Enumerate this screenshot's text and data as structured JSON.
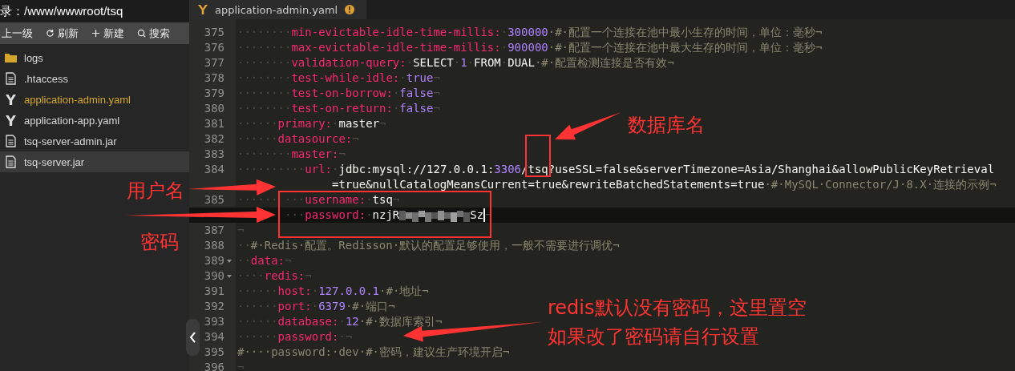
{
  "file_panel": {
    "path": "录：/www/wwwroot/tsq",
    "toolbar": [
      {
        "kind": "up",
        "label": "上一级"
      },
      {
        "kind": "refresh",
        "label": "刷新"
      },
      {
        "kind": "new",
        "label": "新建"
      },
      {
        "kind": "search",
        "label": "搜索"
      }
    ],
    "files": [
      {
        "kind": "folder",
        "name": "logs",
        "selected": false,
        "hovered": false
      },
      {
        "kind": "doc",
        "name": ".htaccess",
        "selected": false,
        "hovered": false
      },
      {
        "kind": "yaml",
        "name": "application-admin.yaml",
        "selected": true,
        "hovered": false
      },
      {
        "kind": "yaml",
        "name": "application-app.yaml",
        "selected": false,
        "hovered": false
      },
      {
        "kind": "doc",
        "name": "tsq-server-admin.jar",
        "selected": false,
        "hovered": false
      },
      {
        "kind": "doc",
        "name": "tsq-server.jar",
        "selected": false,
        "hovered": true
      }
    ]
  },
  "editor": {
    "tab": {
      "title": "application-admin.yaml",
      "warning": true
    },
    "lines": [
      {
        "number": "375",
        "current": false,
        "tokens": [
          {
            "kind": "ws",
            "text": "········"
          },
          {
            "kind": "key",
            "text": "min-evictable-idle-time-millis:"
          },
          {
            "kind": "ws",
            "text": "·"
          },
          {
            "kind": "number",
            "text": "300000"
          },
          {
            "kind": "comment",
            "text": "·#·配置一个连接在池中最小生存的时间，单位：毫秒¬"
          }
        ]
      },
      {
        "number": "376",
        "current": false,
        "tokens": [
          {
            "kind": "ws",
            "text": "········"
          },
          {
            "kind": "key",
            "text": "max-evictable-idle-time-millis:"
          },
          {
            "kind": "ws",
            "text": "·"
          },
          {
            "kind": "number",
            "text": "900000"
          },
          {
            "kind": "comment",
            "text": "·#·配置一个连接在池中最大生存的时间，单位：毫秒¬"
          }
        ]
      },
      {
        "number": "377",
        "current": false,
        "tokens": [
          {
            "kind": "ws",
            "text": "········"
          },
          {
            "kind": "key",
            "text": "validation-query:"
          },
          {
            "kind": "ws",
            "text": "·"
          },
          {
            "kind": "plain",
            "text": "SELECT"
          },
          {
            "kind": "ws",
            "text": "·"
          },
          {
            "kind": "number",
            "text": "1"
          },
          {
            "kind": "ws",
            "text": "·"
          },
          {
            "kind": "plain",
            "text": "FROM"
          },
          {
            "kind": "ws",
            "text": "·"
          },
          {
            "kind": "plain",
            "text": "DUAL"
          },
          {
            "kind": "comment",
            "text": "·#·配置检测连接是否有效¬"
          }
        ]
      },
      {
        "number": "378",
        "current": false,
        "tokens": [
          {
            "kind": "ws",
            "text": "········"
          },
          {
            "kind": "key",
            "text": "test-while-idle:"
          },
          {
            "kind": "ws",
            "text": "·"
          },
          {
            "kind": "number",
            "text": "true"
          },
          {
            "kind": "ws",
            "text": "¬"
          }
        ]
      },
      {
        "number": "379",
        "current": false,
        "tokens": [
          {
            "kind": "ws",
            "text": "········"
          },
          {
            "kind": "key",
            "text": "test-on-borrow:"
          },
          {
            "kind": "ws",
            "text": "·"
          },
          {
            "kind": "number",
            "text": "false"
          },
          {
            "kind": "ws",
            "text": "¬"
          }
        ]
      },
      {
        "number": "380",
        "current": false,
        "tokens": [
          {
            "kind": "ws",
            "text": "········"
          },
          {
            "kind": "key",
            "text": "test-on-return:"
          },
          {
            "kind": "ws",
            "text": "·"
          },
          {
            "kind": "number",
            "text": "false"
          },
          {
            "kind": "ws",
            "text": "¬"
          }
        ]
      },
      {
        "number": "381",
        "current": false,
        "tokens": [
          {
            "kind": "ws",
            "text": "······"
          },
          {
            "kind": "key",
            "text": "primary:"
          },
          {
            "kind": "ws",
            "text": "·"
          },
          {
            "kind": "plain",
            "text": "master"
          },
          {
            "kind": "ws",
            "text": "¬"
          }
        ]
      },
      {
        "number": "382",
        "current": false,
        "tokens": [
          {
            "kind": "ws",
            "text": "······"
          },
          {
            "kind": "key",
            "text": "datasource:"
          },
          {
            "kind": "ws",
            "text": "¬"
          }
        ]
      },
      {
        "number": "383",
        "current": false,
        "tokens": [
          {
            "kind": "ws",
            "text": "········"
          },
          {
            "kind": "key",
            "text": "master:"
          },
          {
            "kind": "ws",
            "text": "¬"
          }
        ]
      },
      {
        "number": "384",
        "current": false,
        "tokens": [
          {
            "kind": "ws",
            "text": "··········"
          },
          {
            "kind": "key",
            "text": "url:"
          },
          {
            "kind": "ws",
            "text": "·"
          },
          {
            "kind": "plain",
            "text": "jdbc:mysql://127.0.0.1:"
          },
          {
            "kind": "number",
            "text": "3306"
          },
          {
            "kind": "plain",
            "text": "/tsq?useSSL=false&serverTimezone=Asia/Shanghai&allowPublicKeyRetrieval"
          }
        ],
        "continuation": [
          {
            "kind": "plain",
            "text": "=true&nullCatalogMeansCurrent=true&rewriteBatchedStatements=true"
          },
          {
            "kind": "comment",
            "text": "·#·MySQL·Connector/J·8.X·连接的示例¬"
          }
        ]
      },
      {
        "number": "385",
        "current": false,
        "tokens": [
          {
            "kind": "ws",
            "text": "······"
          },
          {
            "kind": "gap"
          },
          {
            "kind": "ws",
            "text": "···"
          },
          {
            "kind": "key",
            "text": "username:"
          },
          {
            "kind": "ws",
            "text": "·"
          },
          {
            "kind": "plain",
            "text": "tsq"
          },
          {
            "kind": "ws",
            "text": "¬"
          }
        ]
      },
      {
        "current": true,
        "tokens": [
          {
            "kind": "covered"
          },
          {
            "kind": "gap"
          },
          {
            "kind": "ws",
            "text": "···"
          },
          {
            "kind": "key",
            "text": "password:"
          },
          {
            "kind": "ws",
            "text": "·"
          },
          {
            "kind": "plain",
            "text": "nzjR"
          },
          {
            "kind": "redacted"
          },
          {
            "kind": "plain",
            "text": "Sz"
          },
          {
            "kind": "cursor"
          },
          {
            "kind": "ws",
            "text": "¬"
          }
        ]
      },
      {
        "number": "387",
        "current": false,
        "tokens": [
          {
            "kind": "ws",
            "text": "¬"
          }
        ]
      },
      {
        "number": "388",
        "current": false,
        "tokens": [
          {
            "kind": "ws",
            "text": "··"
          },
          {
            "kind": "comment",
            "text": "#·Redis·配置。Redisson·默认的配置足够使用，一般不需要进行调优¬"
          }
        ]
      },
      {
        "number": "389",
        "current": false,
        "folded": false,
        "tokens": [
          {
            "kind": "ws",
            "text": "··"
          },
          {
            "kind": "key",
            "text": "data:"
          },
          {
            "kind": "ws",
            "text": "¬"
          }
        ]
      },
      {
        "number": "390",
        "current": false,
        "folded": false,
        "tokens": [
          {
            "kind": "ws",
            "text": "····"
          },
          {
            "kind": "key",
            "text": "redis:"
          },
          {
            "kind": "ws",
            "text": "¬"
          }
        ]
      },
      {
        "number": "391",
        "current": false,
        "tokens": [
          {
            "kind": "ws",
            "text": "······"
          },
          {
            "kind": "key",
            "text": "host:"
          },
          {
            "kind": "ws",
            "text": "·"
          },
          {
            "kind": "number",
            "text": "127.0.0.1"
          },
          {
            "kind": "comment",
            "text": "·#·地址¬"
          }
        ]
      },
      {
        "number": "392",
        "current": false,
        "tokens": [
          {
            "kind": "ws",
            "text": "······"
          },
          {
            "kind": "key",
            "text": "port:"
          },
          {
            "kind": "ws",
            "text": "·"
          },
          {
            "kind": "number",
            "text": "6379"
          },
          {
            "kind": "comment",
            "text": "·#·端口¬"
          }
        ]
      },
      {
        "number": "393",
        "current": false,
        "tokens": [
          {
            "kind": "ws",
            "text": "······"
          },
          {
            "kind": "key",
            "text": "database:"
          },
          {
            "kind": "ws",
            "text": "·"
          },
          {
            "kind": "number",
            "text": "12"
          },
          {
            "kind": "comment",
            "text": "·#·数据库索引¬"
          }
        ]
      },
      {
        "number": "394",
        "current": false,
        "tokens": [
          {
            "kind": "ws",
            "text": "······"
          },
          {
            "kind": "key",
            "text": "password:"
          },
          {
            "kind": "ws",
            "text": "·¬"
          }
        ]
      },
      {
        "number": "395",
        "current": false,
        "tokens": [
          {
            "kind": "comment",
            "text": "#····password:·dev·#·密码，建议生产环境开启¬"
          }
        ]
      },
      {
        "number": "396",
        "current": false,
        "tokens": [
          {
            "kind": "ws",
            "text": "¬"
          }
        ]
      }
    ]
  },
  "annotations": [
    {
      "kind": "label",
      "text": "数据库名"
    },
    {
      "kind": "label",
      "text": "用户名"
    },
    {
      "kind": "label",
      "text": "密码"
    },
    {
      "kind": "label",
      "text": "redis默认没有密码，这里置空"
    },
    {
      "kind": "label",
      "text": "如果改了密码请自行设置"
    },
    {
      "kind": "box"
    },
    {
      "kind": "box"
    },
    {
      "kind": "arrow"
    },
    {
      "kind": "arrow"
    },
    {
      "kind": "arrow"
    },
    {
      "kind": "arrow"
    }
  ]
}
